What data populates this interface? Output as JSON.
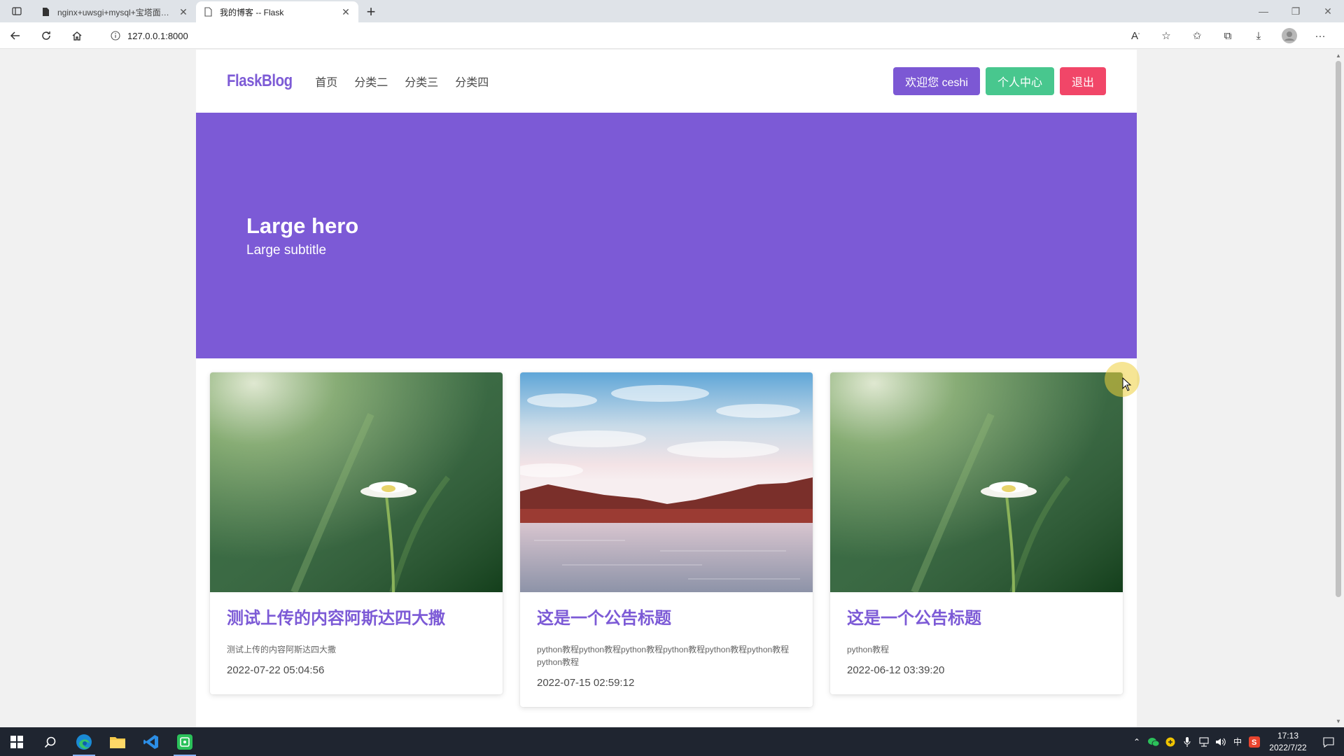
{
  "browser": {
    "tabs": [
      {
        "title": "nginx+uwsgi+mysql+宝塔面板部",
        "icon": "document-icon",
        "active": false
      },
      {
        "title": "我的博客 -- Flask",
        "icon": "page-icon",
        "active": true
      }
    ],
    "url": "127.0.0.1:8000"
  },
  "site": {
    "logo": "FlaskBlog",
    "nav_links": [
      "首页",
      "分类二",
      "分类三",
      "分类四"
    ],
    "welcome_button": "欢迎您 ceshi",
    "center_button": "个人中心",
    "logout_button": "退出"
  },
  "hero": {
    "title": "Large hero",
    "subtitle": "Large subtitle",
    "color": "#7c5ad6"
  },
  "cards": [
    {
      "title": "测试上传的内容阿斯达四大撒",
      "desc": "测试上传的内容阿斯达四大撒",
      "date": "2022-07-22 05:04:56",
      "image": "daisy-photo"
    },
    {
      "title": "这是一个公告标题",
      "desc": "python教程python教程python教程python教程python教程python教程python教程",
      "date": "2022-07-15 02:59:12",
      "image": "lake-sky-photo"
    },
    {
      "title": "这是一个公告标题",
      "desc": "python教程",
      "date": "2022-06-12 03:39:20",
      "image": "daisy-photo"
    }
  ],
  "taskbar": {
    "apps": [
      "windows-start-icon",
      "search-icon",
      "edge-icon",
      "file-explorer-icon",
      "vscode-icon",
      "wechat-devtools-icon"
    ],
    "ime": "中",
    "time": "17:13",
    "date": "2022/7/22"
  },
  "colors": {
    "accent": "#7c5ad6",
    "success": "#48c78e",
    "danger": "#f14668"
  }
}
